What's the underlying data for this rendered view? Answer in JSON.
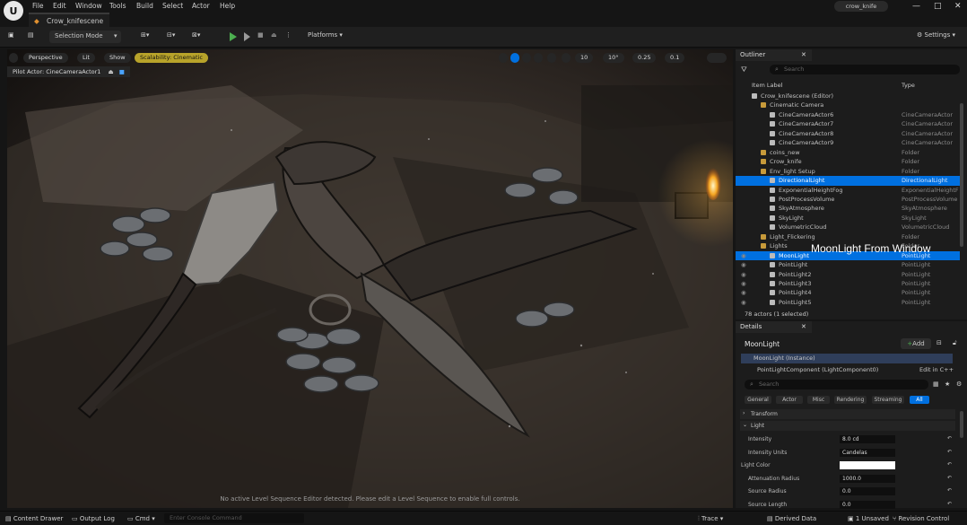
{
  "menubar": {
    "items": [
      "File",
      "Edit",
      "Window",
      "Tools",
      "Build",
      "Select",
      "Actor",
      "Help"
    ],
    "level_tab": "Crow_knifescene",
    "project": "crow_knife"
  },
  "toolbar": {
    "mode": "Selection Mode",
    "platforms": "Platforms",
    "settings": "Settings"
  },
  "viewport": {
    "perspective": "Perspective",
    "lit": "Lit",
    "show": "Show",
    "scalability": "Scalability: Cinematic",
    "pilot": "Pilot Actor: CineCameraActor1",
    "grid": "10",
    "angle": "10°",
    "scale": "0.25",
    "cam_speed": "0.1",
    "status": "No active Level Sequence Editor detected. Please edit a Level Sequence to enable full controls.",
    "overlay": "MoonLight From Window"
  },
  "outliner": {
    "title": "Outliner",
    "search_placeholder": "Search",
    "col_label": "Item Label",
    "col_type": "Type",
    "count": "78 actors (1 selected)",
    "rows": [
      {
        "label": "Crow_knifescene (Editor)",
        "type": "",
        "indent": 0,
        "icon": "level"
      },
      {
        "label": "Cinematic Camera",
        "type": "",
        "indent": 1,
        "icon": "folder"
      },
      {
        "label": "CineCameraActor6",
        "type": "CineCameraActor",
        "indent": 2,
        "icon": "camera"
      },
      {
        "label": "CineCameraActor7",
        "type": "CineCameraActor",
        "indent": 2,
        "icon": "camera"
      },
      {
        "label": "CineCameraActor8",
        "type": "CineCameraActor",
        "indent": 2,
        "icon": "camera"
      },
      {
        "label": "CineCameraActor9",
        "type": "CineCameraActor",
        "indent": 2,
        "icon": "camera"
      },
      {
        "label": "coins_new",
        "type": "Folder",
        "indent": 1,
        "icon": "folder"
      },
      {
        "label": "Crow_knife",
        "type": "Folder",
        "indent": 1,
        "icon": "folder"
      },
      {
        "label": "Env_light Setup",
        "type": "Folder",
        "indent": 1,
        "icon": "folder"
      },
      {
        "label": "DirectionalLight",
        "type": "DirectionalLight",
        "indent": 2,
        "icon": "light",
        "selected": true
      },
      {
        "label": "ExponentialHeightFog",
        "type": "ExponentialHeightF",
        "indent": 2,
        "icon": "fog"
      },
      {
        "label": "PostProcessVolume",
        "type": "PostProcessVolume",
        "indent": 2,
        "icon": "volume"
      },
      {
        "label": "SkyAtmosphere",
        "type": "SkyAtmosphere",
        "indent": 2,
        "icon": "sky"
      },
      {
        "label": "SkyLight",
        "type": "SkyLight",
        "indent": 2,
        "icon": "skylight"
      },
      {
        "label": "VolumetricCloud",
        "type": "VolumetricCloud",
        "indent": 2,
        "icon": "cloud"
      },
      {
        "label": "Light_Flickering",
        "type": "Folder",
        "indent": 1,
        "icon": "folder"
      },
      {
        "label": "Lights",
        "type": "Folder",
        "indent": 1,
        "icon": "folder"
      },
      {
        "label": "MoonLight",
        "type": "PointLight",
        "indent": 2,
        "icon": "bulb",
        "selected": true
      },
      {
        "label": "PointLight",
        "type": "PointLight",
        "indent": 2,
        "icon": "bulb"
      },
      {
        "label": "PointLight2",
        "type": "PointLight",
        "indent": 2,
        "icon": "bulb"
      },
      {
        "label": "PointLight3",
        "type": "PointLight",
        "indent": 2,
        "icon": "bulb"
      },
      {
        "label": "PointLight4",
        "type": "PointLight",
        "indent": 2,
        "icon": "bulb"
      },
      {
        "label": "PointLight5",
        "type": "PointLight",
        "indent": 2,
        "icon": "bulb"
      }
    ]
  },
  "details": {
    "title": "Details",
    "actor": "MoonLight",
    "add": "Add",
    "instance": "MoonLight (Instance)",
    "component": "PointLightComponent (LightComponent0)",
    "edit": "Edit in C++",
    "search_placeholder": "Search",
    "categories": [
      "General",
      "Actor",
      "Misc",
      "Rendering",
      "Streaming",
      "All"
    ],
    "sections": [
      "Transform",
      "Light"
    ],
    "props": [
      {
        "label": "Intensity",
        "value": "8.0 cd"
      },
      {
        "label": "Intensity Units",
        "value": "Candelas"
      },
      {
        "label": "Light Color",
        "value": ""
      },
      {
        "label": "Attenuation Radius",
        "value": "1000.0"
      },
      {
        "label": "Source Radius",
        "value": "0.0"
      },
      {
        "label": "Source Length",
        "value": "0.0"
      }
    ]
  },
  "bottombar": {
    "content_drawer": "Content Drawer",
    "output_log": "Output Log",
    "cmd": "Cmd",
    "console_placeholder": "Enter Console Command",
    "trace": "Trace",
    "derived": "Derived Data",
    "unsaved": "1 Unsaved",
    "revision": "Revision Control"
  }
}
